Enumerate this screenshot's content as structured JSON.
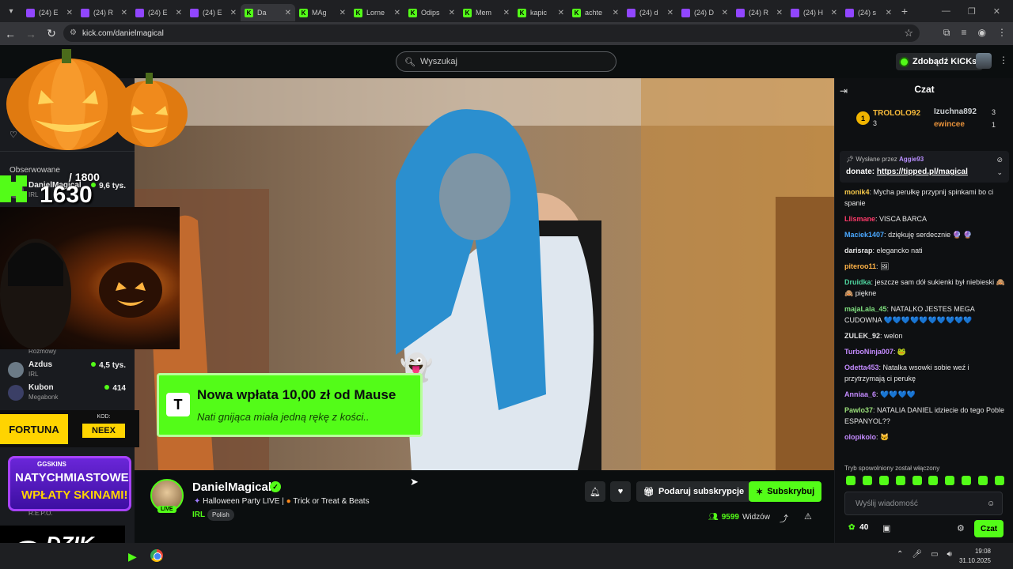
{
  "browser": {
    "tabs": [
      {
        "title": "(24) E",
        "icon": "twitch"
      },
      {
        "title": "(24) R",
        "icon": "twitch"
      },
      {
        "title": "(24) E",
        "icon": "twitch"
      },
      {
        "title": "(24) E",
        "icon": "twitch"
      },
      {
        "title": "Da",
        "icon": "kick",
        "active": true
      },
      {
        "title": "MAg",
        "icon": "kick"
      },
      {
        "title": "Lorne",
        "icon": "kick"
      },
      {
        "title": "Odips",
        "icon": "kick"
      },
      {
        "title": "Mem",
        "icon": "kick"
      },
      {
        "title": "kapic",
        "icon": "kick"
      },
      {
        "title": "achte",
        "icon": "kick"
      },
      {
        "title": "(24) d",
        "icon": "twitch"
      },
      {
        "title": "(24) D",
        "icon": "twitch"
      },
      {
        "title": "(24) R",
        "icon": "twitch"
      },
      {
        "title": "(24) H",
        "icon": "twitch"
      },
      {
        "title": "(24) s",
        "icon": "twitch"
      }
    ],
    "url": "kick.com/danielmagical"
  },
  "header": {
    "search_placeholder": "Wyszukaj",
    "kicks_label": "Zdobądź KICKs"
  },
  "overlay": {
    "counter_goal": "/ 1800",
    "counter_current": "1630",
    "fortuna_label": "FORTUNA",
    "fortuna_code_label": "KOD:",
    "fortuna_code": "NEEX",
    "gg_brand": "GGSKINS",
    "gg_text_1": "NATYCHMIASTOWE",
    "gg_text_2": "WPŁATY SKINAMI!",
    "dzik_label": "DZIK."
  },
  "sidebar": {
    "followed_label": "Obserwowane",
    "first_item_label": "Ob",
    "users": [
      {
        "name": "DanielMagical",
        "category": "IRL",
        "viewers": "9,6 tys."
      },
      {
        "name": "Azdus",
        "category": "IRL",
        "viewers": "4,5 tys."
      },
      {
        "name": "Kubon",
        "category": "Megabonk",
        "viewers": "414"
      }
    ],
    "partial_labels": [
      "Rozmowy",
      "R.E.P.O."
    ]
  },
  "donation": {
    "logo": "T",
    "title": "Nowa wpłata 10,00 zł od Mause",
    "message": "Nati gnijąca miała jedną rękę z kości.."
  },
  "stream": {
    "streamer": "DanielMagical",
    "live_label": "LIVE",
    "title_part1": "Halloween Party LIVE |",
    "title_part2": "Trick or Treat & Beats",
    "category": "IRL",
    "tag": "Polish",
    "gift_label": "Podaruj subskrypcje",
    "subscribe_label": "Subskrybuj",
    "viewers_count": "9599",
    "viewers_label": "Widzów"
  },
  "chat": {
    "title": "Czat",
    "leaderboard": {
      "first": {
        "rank": "1",
        "name": "TROLOLO92",
        "count": "3"
      },
      "second": {
        "name": "Izuchna892",
        "count": "3"
      },
      "third": {
        "name": "ewincee",
        "count": "1"
      }
    },
    "pinned": {
      "sent_by_label": "Wysłane przez",
      "sent_by_user": "Aggie93",
      "prefix": "donate:",
      "link": "https://tipped.pl/magical"
    },
    "messages": [
      {
        "user": "monik4",
        "color": "#f6c94a",
        "text": "Mycha perułkę przypnij spinkami bo ci spanie"
      },
      {
        "user": "Llismane",
        "color": "#ff3a6a",
        "text": "VISCA BARCA"
      },
      {
        "user": "Maciek1407",
        "color": "#4aa8ff",
        "text": "dziękuję serdecznie 🔮 🔮"
      },
      {
        "user": "darisrap",
        "color": "#e6e6e6",
        "text": "elegancko nati"
      },
      {
        "user": "piteroo11",
        "color": "#ffb347",
        "text": "🖼"
      },
      {
        "user": "Druidka",
        "color": "#4fd6a0",
        "text": "jeszcze sam dół sukienki był niebieski 🙈🙈 piękne"
      },
      {
        "user": "majaLala_45",
        "color": "#7fe07f",
        "text": "NATALKO JESTES MEGA CUDOWNA 💙💙💙💙💙💙💙💙💙💙"
      },
      {
        "user": "ZULEK_92",
        "color": "#e6e6e6",
        "text": "welon"
      },
      {
        "user": "TurboNinja007",
        "color": "#c48bff",
        "text": "🐸"
      },
      {
        "user": "Odetta453",
        "color": "#c48bff",
        "text": "Natalka wsowki sobie weź i przytrzymają ci perukę"
      },
      {
        "user": "Anniaa_6",
        "color": "#c48bff",
        "text": "💙💙💙💙"
      },
      {
        "user": "Pawlo37",
        "color": "#9be07a",
        "text": "NATALIA DANIEL idziecie do tego Poble ESPANYOL??"
      },
      {
        "user": "olopikolo",
        "color": "#c48bff",
        "text": "🐱"
      }
    ],
    "slow_mode": "Tryb spowolniony został włączony",
    "input_placeholder": "Wyślij wiadomość",
    "points": "40",
    "send_label": "Czat"
  },
  "taskbar": {
    "time": "19:08",
    "date": "31.10.2025"
  },
  "colors": {
    "accent": "#53fc18",
    "bg": "#0b0e0f",
    "panel": "#191b1f"
  }
}
